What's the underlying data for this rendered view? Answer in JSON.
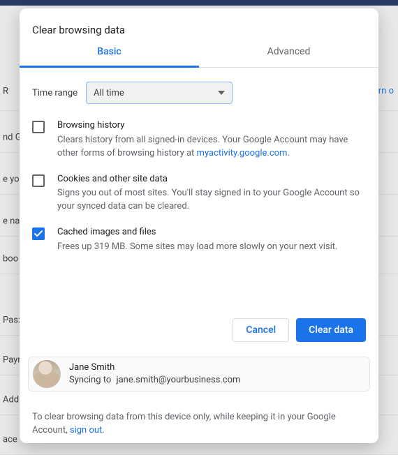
{
  "bg": {
    "rows": [
      "R",
      "nd G",
      "e yo",
      "e na",
      "boo",
      "Pas:",
      "Payr",
      "Add",
      "ace"
    ],
    "turn": "Turn o"
  },
  "dialog": {
    "title": "Clear browsing data",
    "tabs": {
      "basic": "Basic",
      "advanced": "Advanced"
    },
    "time": {
      "label": "Time range",
      "value": "All time"
    },
    "items": {
      "history": {
        "title": "Browsing history",
        "desc1": "Clears history from all signed-in devices. Your Google Account may have other forms of browsing history at ",
        "link": "myactivity.google.com",
        "desc2": "."
      },
      "cookies": {
        "title": "Cookies and other site data",
        "desc": "Signs you out of most sites. You'll stay signed in to your Google Account so your synced data can be cleared."
      },
      "cache": {
        "title": "Cached images and files",
        "desc": "Frees up 319 MB. Some sites may load more slowly on your next visit."
      }
    },
    "buttons": {
      "cancel": "Cancel",
      "clear": "Clear data"
    },
    "profile": {
      "name": "Jane Smith",
      "syncing": "Syncing to",
      "email": "jane.smith@yourbusiness.com"
    },
    "footer": {
      "pre": "To clear browsing data from this device only, while keeping it in your Google Account, ",
      "link": "sign out",
      "post": "."
    }
  }
}
